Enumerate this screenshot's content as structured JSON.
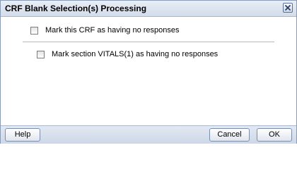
{
  "dialog": {
    "title": "CRF Blank Selection(s) Processing",
    "close_icon": "close-icon"
  },
  "options": {
    "crf_label": "Mark this CRF as having no responses",
    "crf_checked": false,
    "section_label": "Mark section VITALS(1) as having no responses",
    "section_checked": false
  },
  "footer": {
    "help_label": "Help",
    "cancel_label": "Cancel",
    "ok_label": "OK"
  },
  "colors": {
    "titlebar": "#d3dcea",
    "footer": "#cdd7e7",
    "border": "#8a9bb5"
  }
}
